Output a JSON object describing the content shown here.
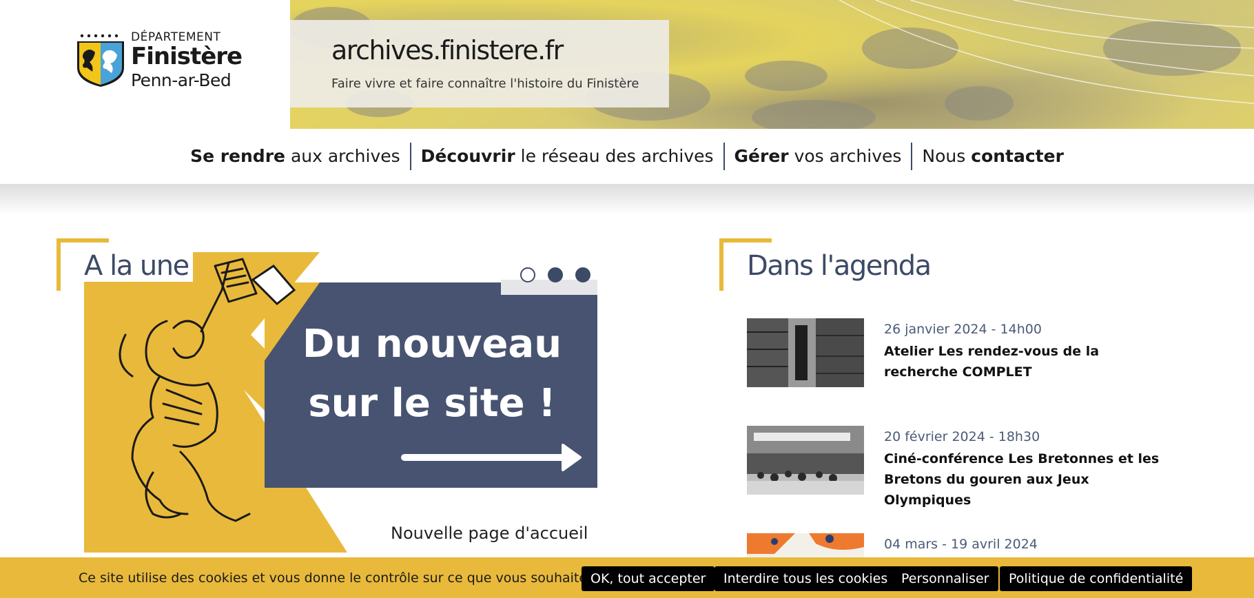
{
  "logo": {
    "line1": "DÉPARTEMENT",
    "line2": "Finistère",
    "line3": "Penn-ar-Bed"
  },
  "banner": {
    "title": "archives.finistere.fr",
    "tagline": "Faire vivre et faire connaître l'histoire du Finistère"
  },
  "nav": {
    "items": [
      {
        "bold": "Se rendre",
        "rest": " aux archives"
      },
      {
        "bold": "Découvrir",
        "rest": " le réseau des archives"
      },
      {
        "bold": "Gérer",
        "rest": " vos archives"
      },
      {
        "pre": "Nous ",
        "bold": "contacter"
      }
    ]
  },
  "une": {
    "heading": "A la une",
    "slide_text_line1": "Du nouveau",
    "slide_text_line2": "sur le site !",
    "caption": "Nouvelle page d'accueil",
    "carousel": {
      "count": 3,
      "active": 0
    }
  },
  "agenda": {
    "heading": "Dans l'agenda",
    "items": [
      {
        "date": "26 janvier 2024 - 14h00",
        "title": "Atelier Les rendez-vous de la recherche COMPLET"
      },
      {
        "date": "20 février 2024 - 18h30",
        "title": "Ciné-conférence Les Bretonnes et les Bretons du gouren aux Jeux Olympiques"
      },
      {
        "date": "04 mars - 19 avril 2024",
        "title": ""
      }
    ]
  },
  "cookies": {
    "message": "Ce site utilise des cookies et vous donne le contrôle sur ce que vous souhaitez activer",
    "accept": "OK, tout accepter",
    "deny": "Interdire tous les cookies",
    "customize": "Personnaliser",
    "privacy": "Politique de confidentialité"
  },
  "colors": {
    "accent_yellow": "#e8b93a",
    "navy": "#3d4a66",
    "slide_blue": "#475370"
  }
}
